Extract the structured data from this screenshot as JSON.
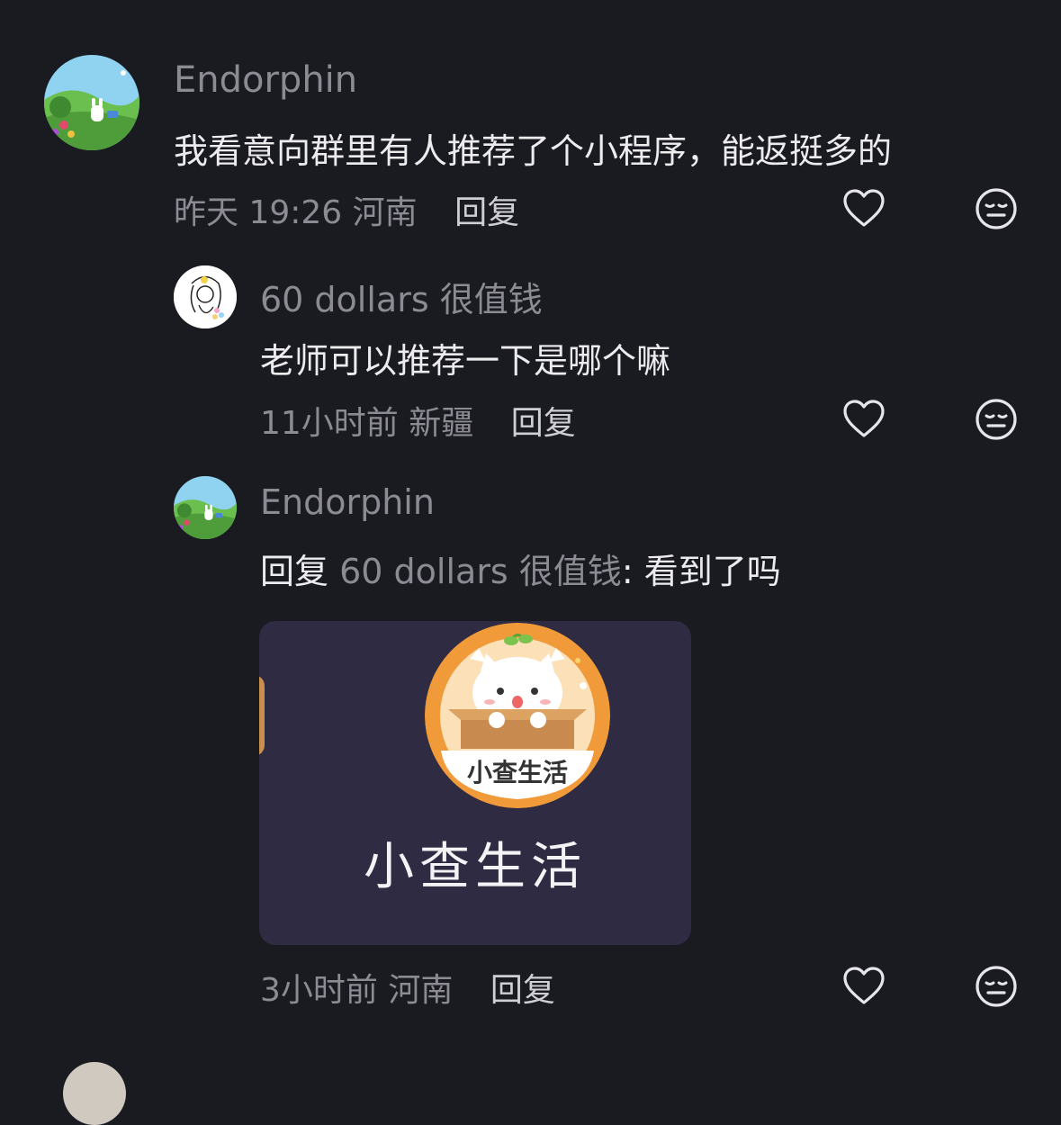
{
  "comments": [
    {
      "username": "Endorphin",
      "text": "我看意向群里有人推荐了个小程序，能返挺多的",
      "time": "昨天 19:26",
      "location": "河南",
      "reply_label": "回复",
      "avatar_icon": "garden-bunny-avatar"
    },
    {
      "username": "60 dollars 很值钱",
      "text": "老师可以推荐一下是哪个嘛",
      "time": "11小时前",
      "location": "新疆",
      "reply_label": "回复",
      "avatar_icon": "sketch-girl-avatar"
    },
    {
      "username": "Endorphin",
      "reply_prefix": "回复",
      "reply_to": "60 dollars 很值钱",
      "text": ": 看到了吗",
      "time": "3小时前",
      "location": "河南",
      "reply_label": "回复",
      "avatar_icon": "garden-bunny-avatar",
      "card": {
        "logo_text": "小查生活",
        "title": "小查生活",
        "logo_icon": "cat-in-box-logo"
      }
    }
  ],
  "icons": {
    "like": "heart-icon",
    "dislike": "meh-face-icon"
  },
  "colors": {
    "background": "#1a1a21",
    "card": "#2f2b42",
    "muted": "#8c8b93",
    "text": "#ececef",
    "logo_orange": "#f19a3a"
  }
}
